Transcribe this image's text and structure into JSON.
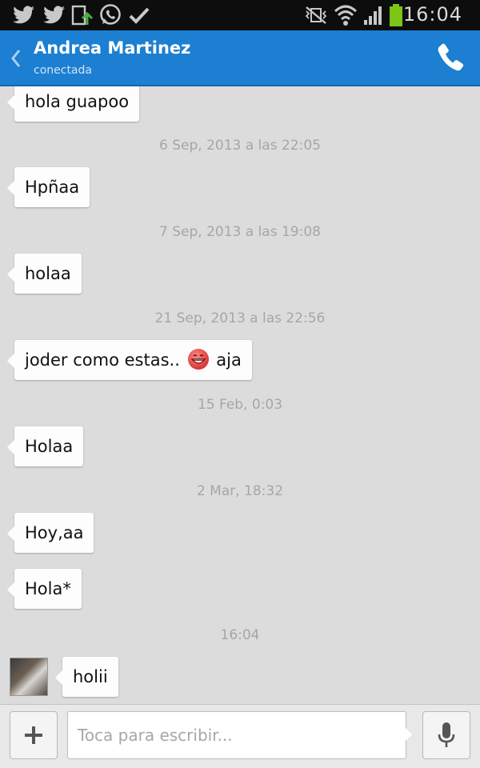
{
  "status_bar": {
    "time": "16:04",
    "left_icons": [
      "twitter-icon",
      "twitter-icon",
      "download-icon",
      "whatsapp-icon",
      "check-icon"
    ],
    "right_icons": [
      "vibrate-mute-icon",
      "wifi-icon",
      "signal-icon",
      "battery-icon"
    ]
  },
  "header": {
    "contact_name": "Andrea Martinez",
    "status": "conectada",
    "color": "#1c7fd1"
  },
  "messages": [
    {
      "type": "bubble",
      "text": "hola guapoo"
    },
    {
      "type": "timestamp",
      "text": "6 Sep, 2013 a las 22:05"
    },
    {
      "type": "bubble",
      "text": "Hpñaa"
    },
    {
      "type": "timestamp",
      "text": "7 Sep, 2013 a las 19:08"
    },
    {
      "type": "bubble",
      "text": "holaa"
    },
    {
      "type": "timestamp",
      "text": "21 Sep, 2013 a las 22:56"
    },
    {
      "type": "bubble",
      "text_before": "joder como estas..",
      "emoji": "grinning-face-icon",
      "text_after": "aja"
    },
    {
      "type": "timestamp",
      "text": "15 Feb, 0:03"
    },
    {
      "type": "bubble",
      "text": "Holaa"
    },
    {
      "type": "timestamp",
      "text": "2 Mar, 18:32"
    },
    {
      "type": "bubble",
      "text": "Hoy,aa"
    },
    {
      "type": "bubble",
      "text": "Hola*"
    },
    {
      "type": "timestamp",
      "text": "16:04"
    },
    {
      "type": "bubble",
      "text": "holii"
    }
  ],
  "input": {
    "placeholder": "Toca para escribir...",
    "value": ""
  }
}
